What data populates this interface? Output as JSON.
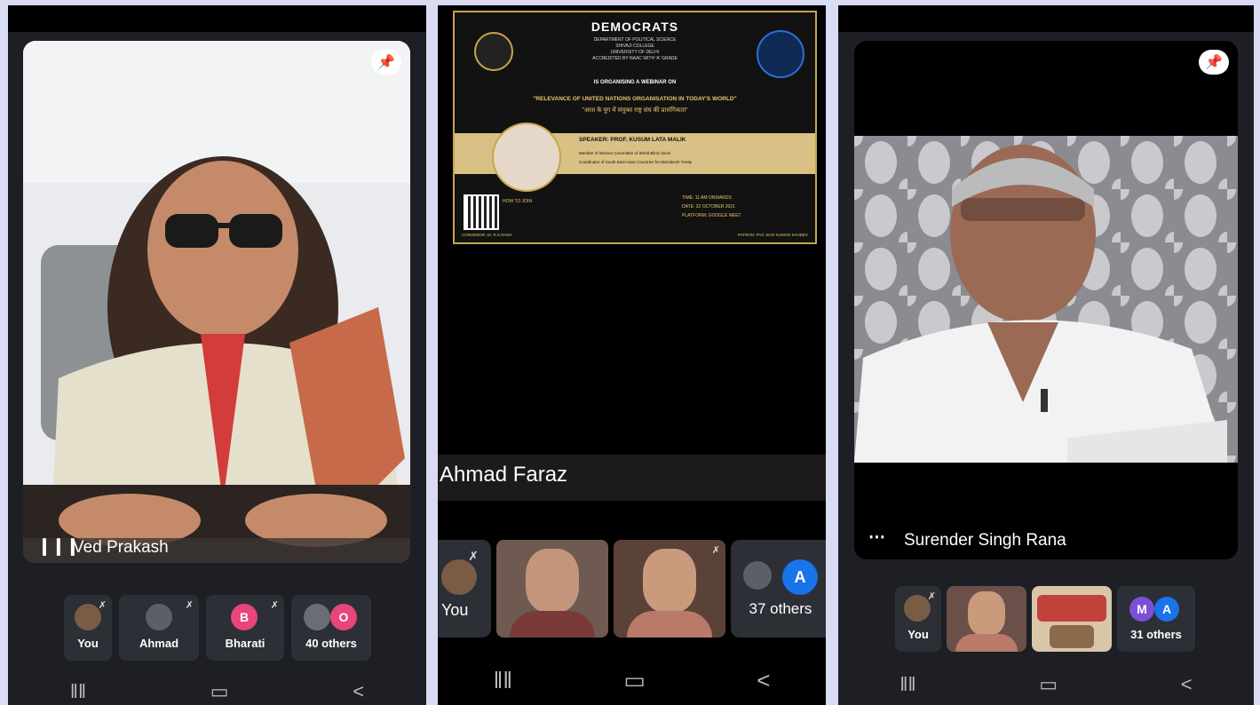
{
  "screen1": {
    "speaker_name": "Ved Prakash",
    "participants": [
      {
        "label": "You",
        "kind": "avatar"
      },
      {
        "label": "Ahmad",
        "kind": "avatar"
      },
      {
        "label": "Bharati",
        "kind": "initial",
        "initial": "B",
        "color": "#e8457a"
      },
      {
        "label": "40 others",
        "kind": "others",
        "initial": "O",
        "color": "#e8457a"
      }
    ]
  },
  "screen2": {
    "poster": {
      "title": "DEMOCRATS",
      "org_lines": [
        "DEPARTMENT OF POLITICAL SCIENCE",
        "SHIVAJI COLLEGE",
        "UNIVERSITY OF DELHI",
        "ACCREDITED BY NAAC WITH 'A' GRADE"
      ],
      "organising": "IS ORGANISING A WEBINAR ON",
      "topic": "\"RELEVANCE OF UNITED NATIONS ORGANISATION IN TODAY'S WORLD\"",
      "topic_hindi": "\"आज के युग में संयुक्त राष्ट्र संघ की प्रासंगिकता\"",
      "speaker": "SPEAKER: PROF. KUSUM LATA MALIK",
      "speaker_points": [
        "Member of Women Committee of World Blind Union",
        "Coordinator of South East Asian Countries for Marrakesh Treaty"
      ],
      "join": "HOW TO JOIN",
      "time": "TIME: 11 AM ONWARDS",
      "date": "DATE: 22 OCTOBER 2021",
      "platform": "PLATFORM: GOOGLE MEET",
      "convenor": "CONVENOR: Dr. R.S.RANA",
      "patron": "PATRON: Prof. SHIV KUMAR SAHDEV"
    },
    "presenter_name": "Ahmad Faraz",
    "participants": [
      {
        "label": "You",
        "kind": "avatar"
      },
      {
        "label": "",
        "kind": "video"
      },
      {
        "label": "",
        "kind": "video"
      },
      {
        "label": "37 others",
        "kind": "others",
        "initial": "A",
        "color": "#1a73e8"
      }
    ]
  },
  "screen3": {
    "speaker_name": "Surender Singh Rana",
    "participants": [
      {
        "label": "You",
        "kind": "avatar"
      },
      {
        "label": "",
        "kind": "video"
      },
      {
        "label": "",
        "kind": "video"
      },
      {
        "label": "31 others",
        "kind": "others",
        "initial1": "M",
        "initial2": "A",
        "color1": "#7b4fd6",
        "color2": "#1a73e8"
      }
    ]
  },
  "icons": {
    "pin": "pin-icon",
    "more": "more-dots-icon",
    "mic_off": "mic-off-icon",
    "recents": "recents-icon",
    "home": "home-icon",
    "back": "back-icon"
  }
}
